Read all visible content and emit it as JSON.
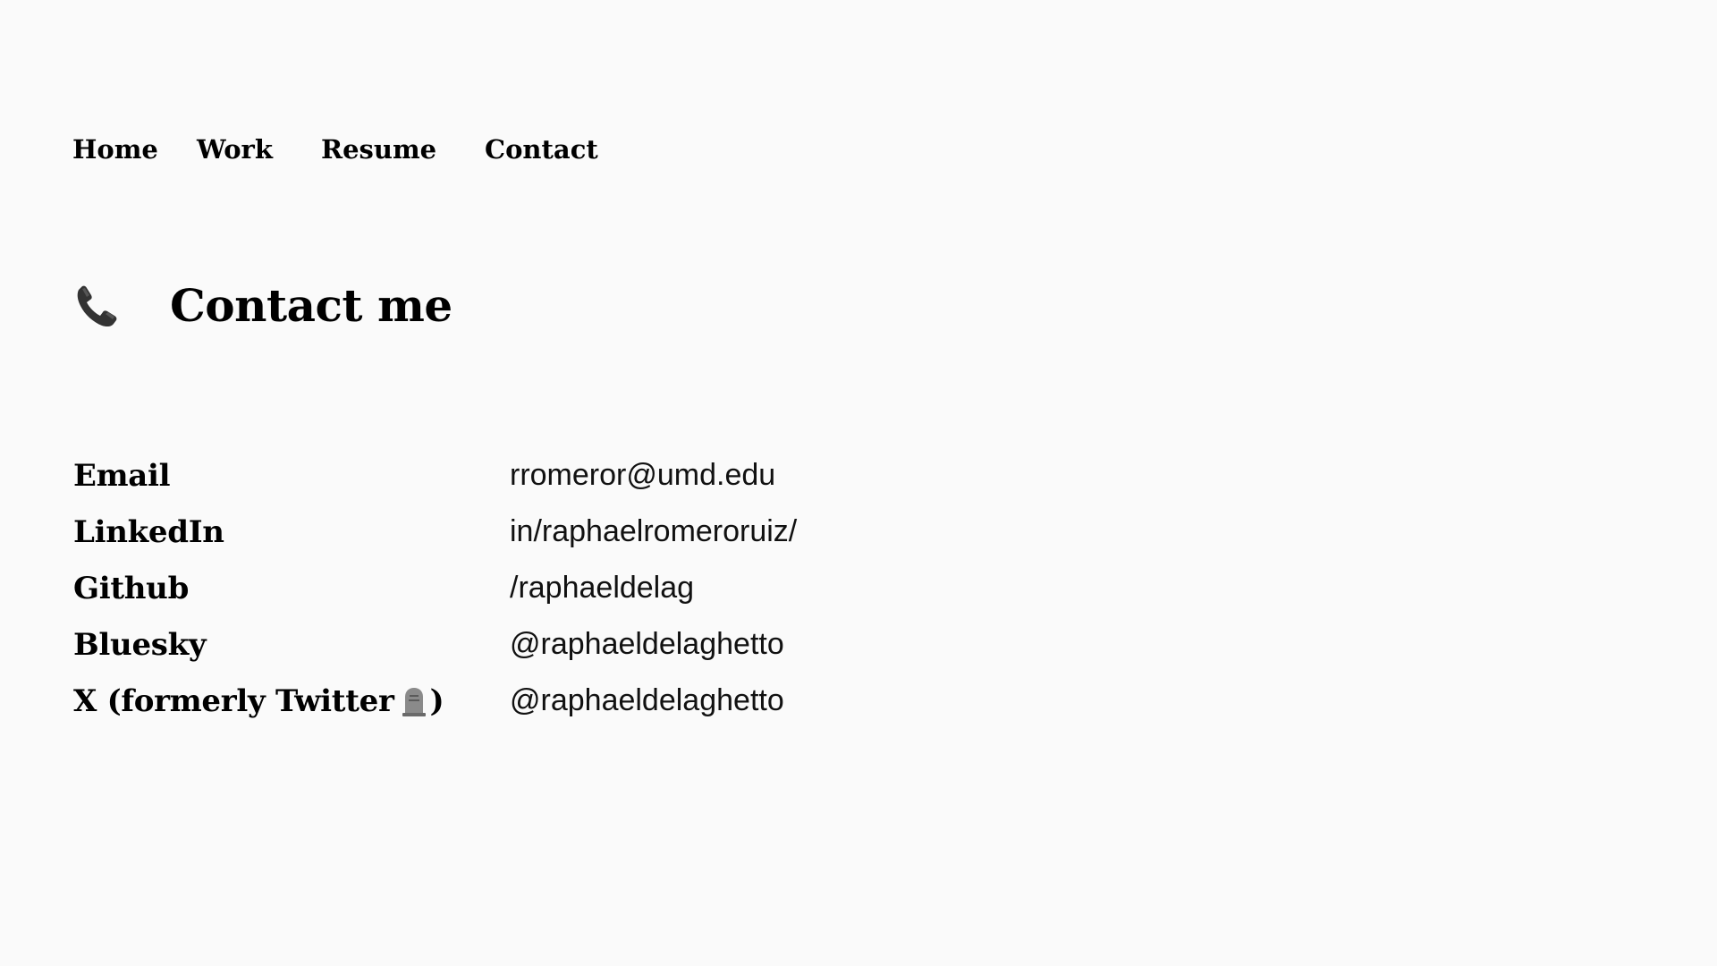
{
  "nav": {
    "home": "Home",
    "work": "Work",
    "resume": "Resume",
    "contact": "Contact"
  },
  "heading": {
    "icon": "telephone-receiver-icon",
    "title": "Contact me"
  },
  "contacts": [
    {
      "label": "Email",
      "value": "rromeror@umd.edu"
    },
    {
      "label": "LinkedIn",
      "value": "in/raphaelromeroruiz/"
    },
    {
      "label": "Github",
      "value": "/raphaeldelag"
    },
    {
      "label": "Bluesky",
      "value": "@raphaeldelaghetto"
    },
    {
      "label_prefix": "X (formerly Twitter",
      "label_suffix": ")",
      "label_icon": "headstone-icon",
      "value": "@raphaeldelaghetto"
    }
  ]
}
